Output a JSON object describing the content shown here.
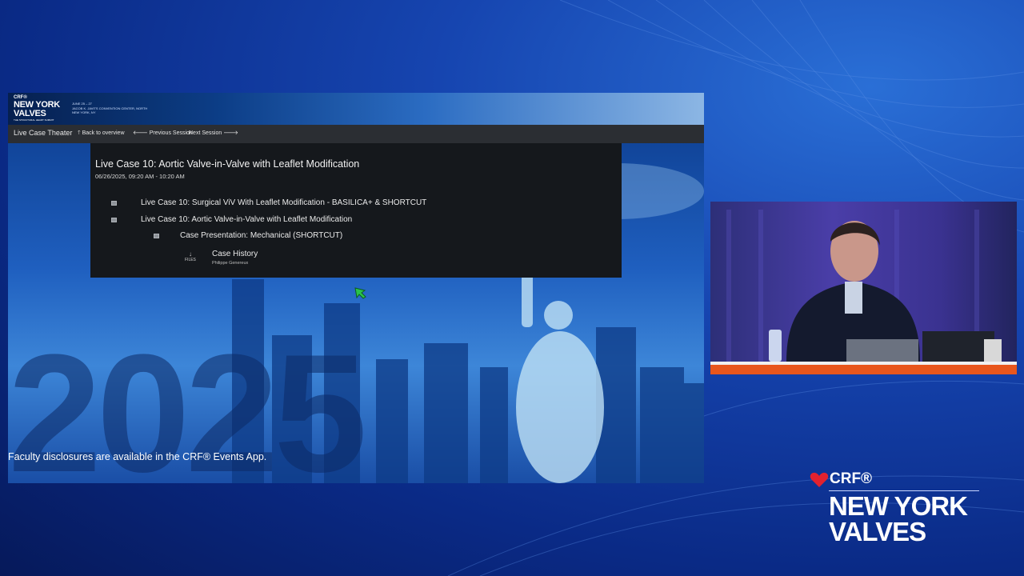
{
  "slide": {
    "banner": {
      "brand_crf": "CRF®",
      "brand_title_line1": "NEW YORK",
      "brand_title_line2": "VALVES",
      "brand_tagline": "THE STRUCTURAL HEART SUMMIT",
      "dates": "JUNE 25 – 27",
      "venue": "JACOB K. JAVITS CONVENTION CENTER, NORTH",
      "city": "NEW YORK, NY"
    },
    "navbar": {
      "title": "Live Case Theater",
      "back": "🡑 Back to overview",
      "previous": "🡐 Previous Session",
      "next": "Next Session 🡒"
    },
    "session": {
      "title": "Live Case 10: Aortic Valve-in-Valve with Leaflet Modification",
      "time": "06/26/2025, 09:20 AM - 10:20 AM",
      "items": [
        {
          "label": "Live Case 10: Surgical ViV With Leaflet Modification - BASILICA+ & SHORTCUT"
        },
        {
          "label": "Live Case 10: Aortic Valve-in-Valve with Leaflet Modification"
        },
        {
          "label": "Case Presentation: Mechanical (SHORTCUT)"
        }
      ],
      "case": {
        "files_label": "FILES",
        "title": "Case History",
        "author": "Philippe Genereux"
      }
    },
    "background_year": "2025",
    "disclaimer": "Faculty disclosures are available in the CRF® Events App."
  },
  "brand": {
    "crf": "CRF®",
    "line1": "NEW YORK",
    "line2": "VALVES"
  },
  "colors": {
    "background": "#0a2a86",
    "navbar": "#2b2e33",
    "panel": "#15181c",
    "accent_orange": "#e8561c",
    "brand_red": "#e2222f"
  }
}
